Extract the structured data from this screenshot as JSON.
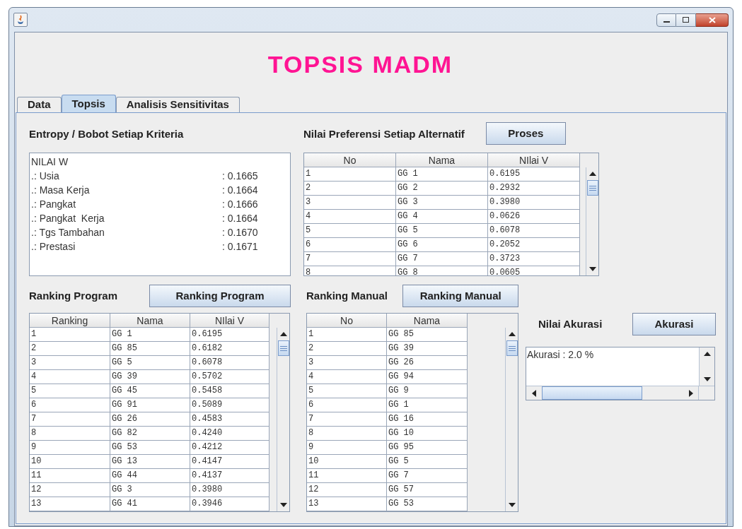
{
  "app_title": "TOPSIS MADM",
  "tabs": [
    {
      "label": "Data",
      "selected": false
    },
    {
      "label": "Topsis",
      "selected": true
    },
    {
      "label": "Analisis Sensitivitas",
      "selected": false
    }
  ],
  "entropy": {
    "title": "Entropy / Bobot Setiap Kriteria",
    "heading": "NILAI W",
    "items": [
      {
        "label": ".: Usia",
        "value": ": 0.1665"
      },
      {
        "label": ".: Masa Kerja",
        "value": ": 0.1664"
      },
      {
        "label": ".: Pangkat",
        "value": ": 0.1666"
      },
      {
        "label": ".: Pangkat  Kerja",
        "value": ": 0.1664"
      },
      {
        "label": ".: Tgs Tambahan",
        "value": ": 0.1670"
      },
      {
        "label": ".: Prestasi",
        "value": ": 0.1671"
      }
    ]
  },
  "preferensi": {
    "title": "Nilai Preferensi Setiap Alternatif",
    "button": "Proses",
    "columns": [
      "No",
      "Nama",
      "NIlai V"
    ],
    "rows": [
      [
        "1",
        "GG 1",
        "0.6195"
      ],
      [
        "2",
        "GG 2",
        "0.2932"
      ],
      [
        "3",
        "GG 3",
        "0.3980"
      ],
      [
        "4",
        "GG 4",
        "0.0626"
      ],
      [
        "5",
        "GG 5",
        "0.6078"
      ],
      [
        "6",
        "GG 6",
        "0.2052"
      ],
      [
        "7",
        "GG 7",
        "0.3723"
      ],
      [
        "8",
        "GG 8",
        "0.0605"
      ]
    ]
  },
  "ranking_program": {
    "title": "Ranking Program",
    "button": "Ranking Program",
    "columns": [
      "Ranking",
      "Nama",
      "NIlai V"
    ],
    "rows": [
      [
        "1",
        "GG 1",
        "0.6195"
      ],
      [
        "2",
        "GG 85",
        "0.6182"
      ],
      [
        "3",
        "GG 5",
        "0.6078"
      ],
      [
        "4",
        "GG 39",
        "0.5702"
      ],
      [
        "5",
        "GG 45",
        "0.5458"
      ],
      [
        "6",
        "GG 91",
        "0.5089"
      ],
      [
        "7",
        "GG 26",
        "0.4583"
      ],
      [
        "8",
        "GG 82",
        "0.4240"
      ],
      [
        "9",
        "GG 53",
        "0.4212"
      ],
      [
        "10",
        "GG 13",
        "0.4147"
      ],
      [
        "11",
        "GG 44",
        "0.4137"
      ],
      [
        "12",
        "GG 3",
        "0.3980"
      ],
      [
        "13",
        "GG 41",
        "0.3946"
      ]
    ]
  },
  "ranking_manual": {
    "title": "Ranking Manual",
    "button": "Ranking Manual",
    "columns": [
      "No",
      "Nama"
    ],
    "rows": [
      [
        "1",
        "GG 85"
      ],
      [
        "2",
        "GG 39"
      ],
      [
        "3",
        "GG 26"
      ],
      [
        "4",
        "GG 94"
      ],
      [
        "5",
        "GG 9"
      ],
      [
        "6",
        "GG 1"
      ],
      [
        "7",
        "GG 16"
      ],
      [
        "8",
        "GG 10"
      ],
      [
        "9",
        "GG 95"
      ],
      [
        "10",
        "GG 5"
      ],
      [
        "11",
        "GG 7"
      ],
      [
        "12",
        "GG 57"
      ],
      [
        "13",
        "GG 53"
      ]
    ]
  },
  "akurasi": {
    "title": "Nilai Akurasi",
    "button": "Akurasi",
    "text": "Akurasi : 2.0 %"
  }
}
